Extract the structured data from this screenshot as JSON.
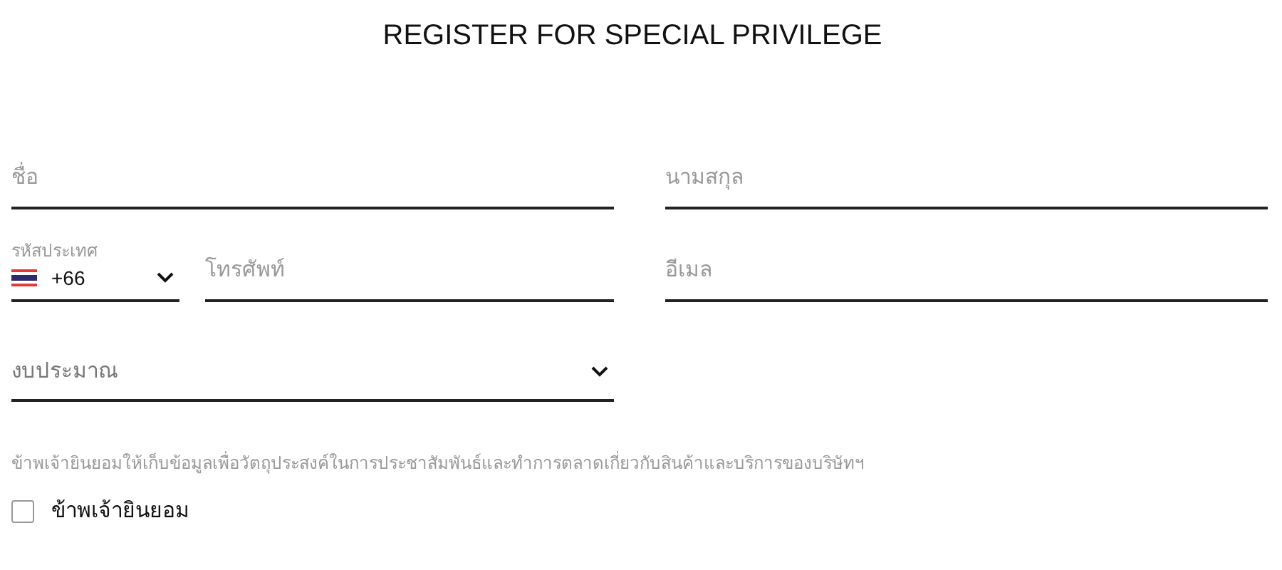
{
  "title": "REGISTER FOR SPECIAL PRIVILEGE",
  "first_name": {
    "placeholder": "ชื่อ"
  },
  "last_name": {
    "placeholder": "นามสกุล"
  },
  "country_code": {
    "label": "รหัสประเทศ",
    "value": "+66"
  },
  "phone": {
    "placeholder": "โทรศัพท์"
  },
  "email": {
    "placeholder": "อีเมล"
  },
  "budget": {
    "placeholder": "งบประมาณ"
  },
  "consent_text": "ข้าพเจ้ายินยอมให้เก็บข้อมูลเพื่อวัตถุประสงค์ในการประชาสัมพันธ์และทำการตลาดเกี่ยวกับสินค้าและบริการของบริษัทฯ",
  "consent": {
    "label": "ข้าพเจ้ายินยอม",
    "checked": false
  }
}
